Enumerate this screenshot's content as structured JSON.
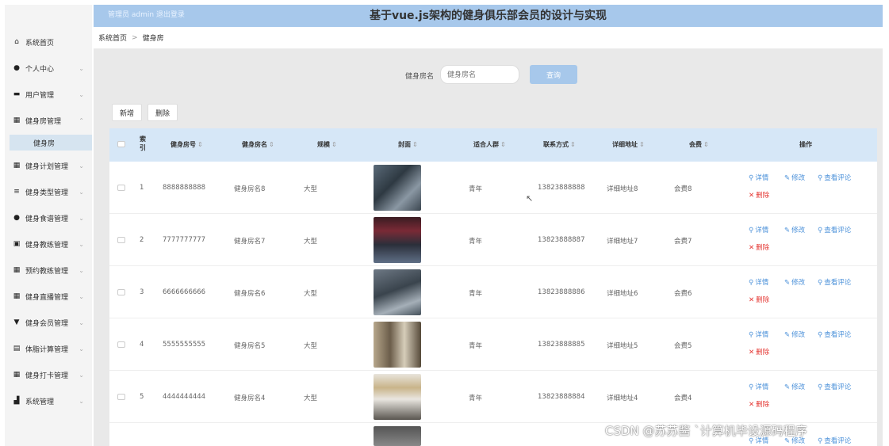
{
  "header": {
    "user_text": "管理员 admin  退出登录",
    "title": "基于vue.js架构的健身俱乐部会员的设计与实现"
  },
  "breadcrumb": {
    "home": "系统首页",
    "separator": ">",
    "current": "健身房"
  },
  "sidebar": {
    "items": [
      {
        "label": "系统首页",
        "icon": "home-icon",
        "glyph": "⌂",
        "chevron": ""
      },
      {
        "label": "个人中心",
        "icon": "user-icon",
        "glyph": "●",
        "chevron": "⌄"
      },
      {
        "label": "用户管理",
        "icon": "users-icon",
        "glyph": "▬",
        "chevron": "⌄"
      },
      {
        "label": "健身房管理",
        "icon": "grid-icon",
        "glyph": "▦",
        "chevron": "⌃"
      },
      {
        "label": "健身计划管理",
        "icon": "grid-icon",
        "glyph": "▦",
        "chevron": "⌄"
      },
      {
        "label": "健身类型管理",
        "icon": "list-icon",
        "glyph": "≡",
        "chevron": "⌄"
      },
      {
        "label": "健身食谱管理",
        "icon": "pin-icon",
        "glyph": "●",
        "chevron": "⌄"
      },
      {
        "label": "健身教练管理",
        "icon": "card-icon",
        "glyph": "▣",
        "chevron": "⌄"
      },
      {
        "label": "预约教练管理",
        "icon": "grid-icon",
        "glyph": "▦",
        "chevron": "⌄"
      },
      {
        "label": "健身直播管理",
        "icon": "grid-icon",
        "glyph": "▦",
        "chevron": "⌄"
      },
      {
        "label": "健身会员管理",
        "icon": "shield-icon",
        "glyph": "▼",
        "chevron": "⌄"
      },
      {
        "label": "体脂计算管理",
        "icon": "calc-icon",
        "glyph": "▤",
        "chevron": "⌄"
      },
      {
        "label": "健身打卡管理",
        "icon": "grid-icon",
        "glyph": "▦",
        "chevron": "⌄"
      },
      {
        "label": "系统管理",
        "icon": "chart-icon",
        "glyph": "▟",
        "chevron": "⌄"
      }
    ],
    "sub_item": "健身房"
  },
  "search": {
    "label": "健身房名",
    "placeholder": "健身房名",
    "button": "查询"
  },
  "toolbar": {
    "add": "新增",
    "delete": "删除"
  },
  "table": {
    "headers": {
      "index_line1": "索",
      "index_line2": "引",
      "number": "健身房号",
      "name": "健身房名",
      "scale": "规模",
      "cover": "封面",
      "crowd": "适合人群",
      "contact": "联系方式",
      "address": "详细地址",
      "fee": "会费",
      "ops": "操作"
    },
    "sort_glyph": "⇕",
    "actions": {
      "detail": "详情",
      "edit": "修改",
      "review": "查看评论",
      "delete": "删除"
    },
    "rows": [
      {
        "index": "1",
        "number": "8888888888",
        "name": "健身房名8",
        "scale": "大型",
        "crowd": "青年",
        "contact": "13823888888",
        "address": "详细地址8",
        "fee": "会费8"
      },
      {
        "index": "2",
        "number": "7777777777",
        "name": "健身房名7",
        "scale": "大型",
        "crowd": "青年",
        "contact": "13823888887",
        "address": "详细地址7",
        "fee": "会费7"
      },
      {
        "index": "3",
        "number": "6666666666",
        "name": "健身房名6",
        "scale": "大型",
        "crowd": "青年",
        "contact": "13823888886",
        "address": "详细地址6",
        "fee": "会费6"
      },
      {
        "index": "4",
        "number": "5555555555",
        "name": "健身房名5",
        "scale": "大型",
        "crowd": "青年",
        "contact": "13823888885",
        "address": "详细地址5",
        "fee": "会费5"
      },
      {
        "index": "5",
        "number": "4444444444",
        "name": "健身房名4",
        "scale": "大型",
        "crowd": "青年",
        "contact": "13823888884",
        "address": "详细地址4",
        "fee": "会费4"
      }
    ],
    "partial_row_actions": {
      "detail": "详情",
      "edit": "修改",
      "review": "查看评论"
    }
  },
  "watermark": "CSDN @苏苏酱   `计算机毕设源码程序"
}
